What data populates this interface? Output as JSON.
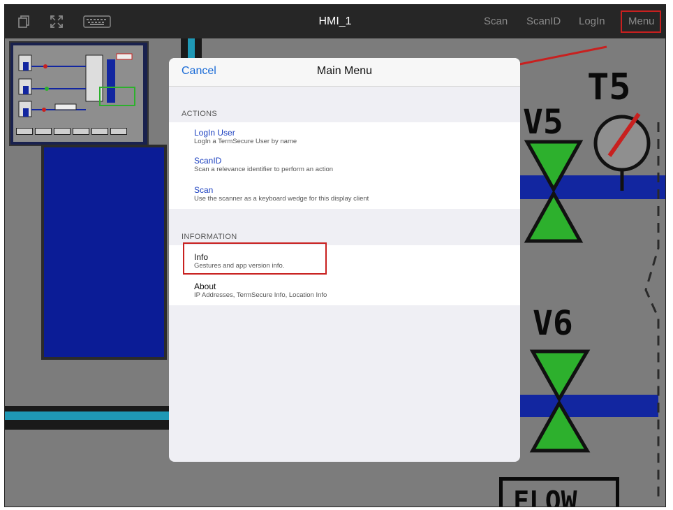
{
  "topbar": {
    "title": "HMI_1",
    "items": [
      "Scan",
      "ScanID",
      "LogIn",
      "Menu"
    ],
    "icons": [
      "copy-icon",
      "fullscreen-icon",
      "keyboard-icon"
    ]
  },
  "background": {
    "tags": [
      "V5",
      "T5",
      "V6"
    ],
    "flow_label": "FLOW"
  },
  "modal": {
    "cancel_label": "Cancel",
    "title": "Main Menu",
    "sections": [
      {
        "label": "ACTIONS",
        "items": [
          {
            "title": "LogIn User",
            "description": "LogIn a TermSecure User by name"
          },
          {
            "title": "ScanID",
            "description": "Scan a relevance identifier to perform an action"
          },
          {
            "title": "Scan",
            "description": "Use the scanner as a keyboard wedge for this display client"
          }
        ]
      },
      {
        "label": "INFORMATION",
        "items": [
          {
            "title": "Info",
            "description": "Gestures and app version info."
          },
          {
            "title": "About",
            "description": "IP Addresses, TermSecure Info, Location Info"
          }
        ]
      }
    ]
  },
  "colors": {
    "accent": "#1a6bd6",
    "highlight": "#c8201f",
    "pipe_blue": "#1226a0",
    "valve_green": "#2db02d"
  }
}
